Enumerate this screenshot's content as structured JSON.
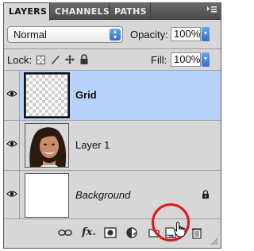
{
  "tabs": [
    {
      "label": "LAYERS",
      "active": true
    },
    {
      "label": "CHANNELS",
      "active": false
    },
    {
      "label": "PATHS",
      "active": false
    }
  ],
  "panel_menu_icon": "panel-menu-icon",
  "blend_mode": {
    "value": "Normal"
  },
  "opacity": {
    "label": "Opacity:",
    "value": "100%"
  },
  "lock": {
    "label": "Lock:",
    "icons": [
      "lock-transparent-pixels-icon",
      "lock-image-pixels-icon",
      "lock-position-icon",
      "lock-all-icon"
    ]
  },
  "fill": {
    "label": "Fill:",
    "value": "100%"
  },
  "layers": [
    {
      "name": "Grid",
      "visible": true,
      "selected": true,
      "thumbnail": "transparent"
    },
    {
      "name": "Layer 1",
      "visible": true,
      "selected": false,
      "thumbnail": "photo-woman-portrait"
    },
    {
      "name": "Background",
      "visible": true,
      "selected": false,
      "thumbnail": "white",
      "locked": true
    }
  ],
  "bottom_toolbar": {
    "icons": [
      "link-layers-icon",
      "layer-style-fx-icon",
      "add-layer-mask-icon",
      "new-adjustment-layer-icon",
      "new-group-folder-icon",
      "new-layer-icon",
      "delete-layer-trash-icon"
    ],
    "fx_label": "fx."
  },
  "colors": {
    "panel_bg": "#d7d7d7",
    "selection": "#b7d3fb",
    "highlight_circle": "#e2161a",
    "accent_blue": "#3478d8"
  }
}
